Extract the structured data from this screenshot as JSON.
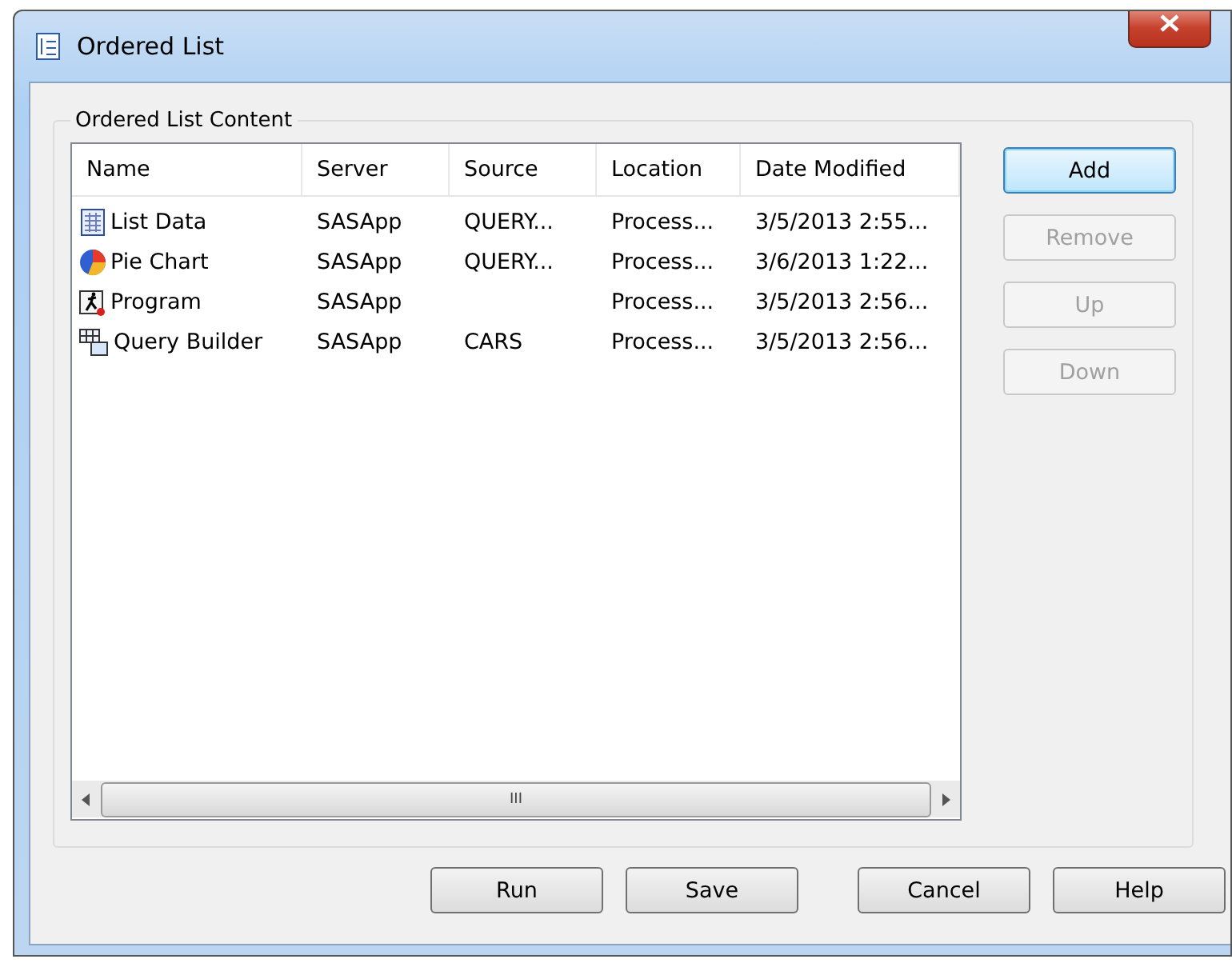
{
  "window": {
    "title": "Ordered List"
  },
  "group": {
    "title": "Ordered List Content"
  },
  "table": {
    "columns": [
      "Name",
      "Server",
      "Source",
      "Location",
      "Date Modified"
    ],
    "rows": [
      {
        "kind": "data",
        "cells": [
          "List Data",
          "SASApp",
          "QUERY...",
          "Process...",
          "3/5/2013 2:55..."
        ]
      },
      {
        "kind": "pie",
        "cells": [
          "Pie Chart",
          "SASApp",
          "QUERY...",
          "Process...",
          "3/6/2013 1:22..."
        ]
      },
      {
        "kind": "program",
        "cells": [
          "Program",
          "SASApp",
          "",
          "Process...",
          "3/5/2013 2:56..."
        ]
      },
      {
        "kind": "query",
        "cells": [
          "Query Builder",
          "SASApp",
          "CARS",
          "Process...",
          "3/5/2013 2:56..."
        ]
      }
    ],
    "scrollbar": {
      "grip": "III"
    }
  },
  "side_buttons": [
    {
      "label": "Add",
      "disabled": false,
      "focused": true
    },
    {
      "label": "Remove",
      "disabled": true,
      "focused": false
    },
    {
      "label": "Up",
      "disabled": true,
      "focused": false
    },
    {
      "label": "Down",
      "disabled": true,
      "focused": false
    }
  ],
  "bottom_buttons": [
    "Run",
    "Save",
    "Cancel",
    "Help"
  ]
}
